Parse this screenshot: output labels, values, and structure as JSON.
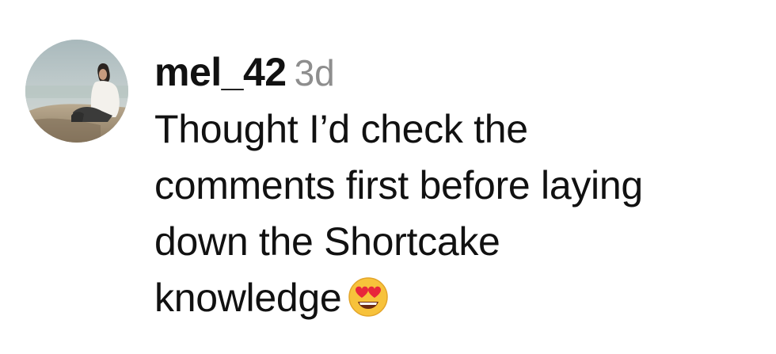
{
  "comment": {
    "username": "mel_42",
    "timestamp": "3d",
    "text_lines": [
      "Thought I’d check the",
      "comments first before laying",
      "down the Shortcake",
      "knowledge"
    ],
    "emoji": "smiling-face-with-heart-eyes-emoji"
  },
  "colors": {
    "text": "#111111",
    "timestamp": "#8e8e8e",
    "background": "#ffffff",
    "emoji_face": "#f7c23b",
    "emoji_hearts": "#e8273b"
  }
}
